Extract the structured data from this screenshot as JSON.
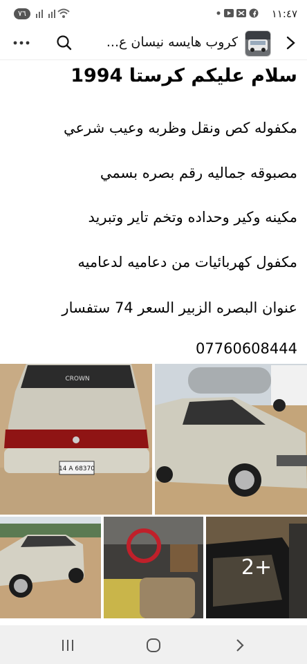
{
  "status_bar": {
    "time": "١١:٤٧",
    "battery_label": "٧٦"
  },
  "header": {
    "group_title": "كروب هايسه نيسان ع..."
  },
  "post": {
    "title": "سلام عليكم كرستا 1994",
    "lines": [
      "مكفوله كص ونقل وظربه وعيب شرعي",
      "مصبوقه جماليه رقم بصره بسمي",
      "مكينه وكير وحداده وتخم تاير وتبريد",
      "مكفول كهربائيات من دعاميه لدعاميه",
      "عنوان البصره الزبير السعر 74 ستفسار",
      "07760608444"
    ]
  },
  "photos": {
    "plate": "14 A 68370",
    "more_label": "2+"
  },
  "icons": {
    "back": "back-arrow-icon",
    "search": "search-icon",
    "more": "more-dots-icon",
    "recents": "recents-icon",
    "home": "home-icon",
    "nav_back": "nav-back-icon"
  },
  "colors": {
    "nav_bg": "#f0f0f0",
    "text": "#050505",
    "car_silver": "#c9c6b8"
  }
}
